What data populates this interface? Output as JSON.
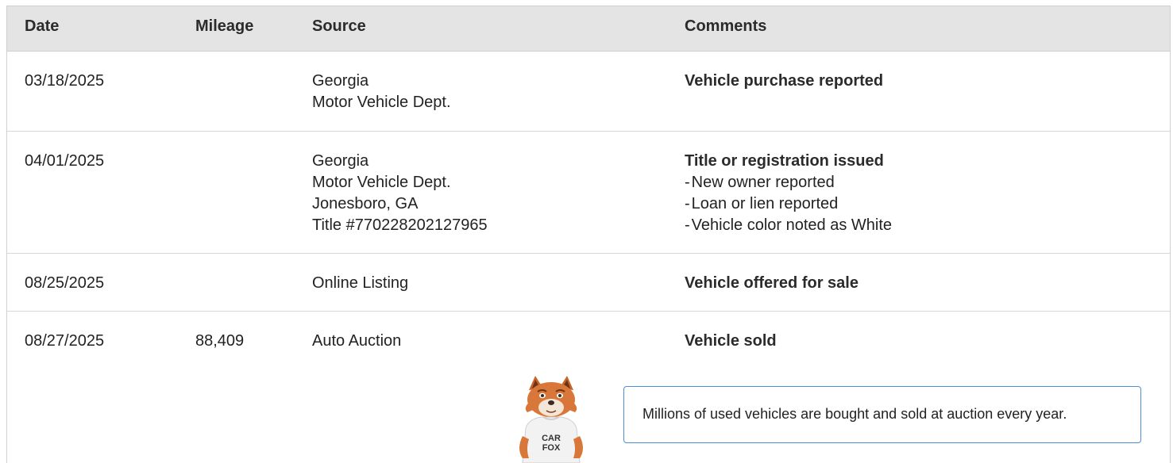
{
  "table": {
    "headers": {
      "date": "Date",
      "mileage": "Mileage",
      "source": "Source",
      "comments": "Comments"
    },
    "rows": [
      {
        "date": "03/18/2025",
        "mileage": "",
        "source": [
          "Georgia",
          "Motor Vehicle Dept."
        ],
        "comment_title": "Vehicle purchase reported",
        "comment_items": []
      },
      {
        "date": "04/01/2025",
        "mileage": "",
        "source": [
          "Georgia",
          "Motor Vehicle Dept.",
          "Jonesboro, GA",
          "Title #770228202127965"
        ],
        "comment_title": "Title or registration issued",
        "comment_items": [
          "New owner reported",
          "Loan or lien reported",
          "Vehicle color noted as White"
        ]
      },
      {
        "date": "08/25/2025",
        "mileage": "",
        "source": [
          "Online Listing"
        ],
        "comment_title": "Vehicle offered for sale",
        "comment_items": []
      },
      {
        "date": "08/27/2025",
        "mileage": "88,409",
        "source": [
          "Auto Auction"
        ],
        "comment_title": "Vehicle sold",
        "comment_items": []
      }
    ]
  },
  "tip": {
    "text": "Millions of used vehicles are bought and sold at auction every year.",
    "mascot_shirt": [
      "CAR",
      "FOX"
    ],
    "mascot_icon": "carfox-mascot-icon",
    "border_color": "#4a8fd8"
  }
}
